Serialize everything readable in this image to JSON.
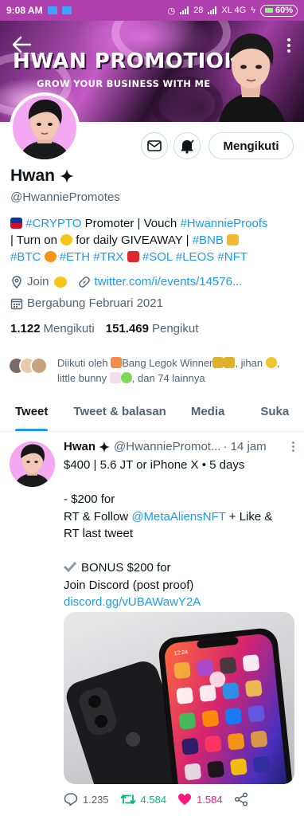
{
  "status_bar": {
    "time": "9:08 AM",
    "notification_badge": "28",
    "network": "XL 4G",
    "battery": "60%"
  },
  "banner": {
    "title": "HWAN PROMOTIONS",
    "subtitle": "GROW YOUR BUSINESS WITH ME"
  },
  "profile": {
    "follow_label": "Mengikuti",
    "name": "Hwan",
    "handle": "@HwanniePromotes",
    "bio": {
      "line1_tag": "#CRYPTO",
      "line1_text": " Promoter | Vouch ",
      "line1_link": "#HwannieProofs",
      "line2_a": "| Turn on ",
      "line2_b": " for daily GIVEAWAY | ",
      "line2_tag": "#BNB",
      "line3_btc": "#BTC",
      "line3_eth": "#ETH",
      "line3_trx": "#TRX",
      "line3_sol": "#SOL",
      "line3_leos": "#LEOS",
      "line3_nft": "#NFT"
    },
    "location": "Join",
    "url": "twitter.com/i/events/14576...",
    "joined": "Bergabung Februari 2021",
    "following_count": "1.122",
    "following_label": "Mengikuti",
    "followers_count": "151.469",
    "followers_label": "Pengikut",
    "followed_by_a": "Diikuti oleh ",
    "followed_by_b": "Bang Legok Winner",
    "followed_by_c": ", jihan",
    "followed_by_d": ", little bunny ",
    "followed_by_e": ", dan 74 lainnya"
  },
  "tabs": [
    "Tweet",
    "Tweet & balasan",
    "Media",
    "Suka"
  ],
  "tweet": {
    "name": "Hwan",
    "handle": "@HwanniePromot...",
    "time": "· 14 jam",
    "lines": {
      "l1": "$400 | 5.6 JT or iPhone X • 5 days",
      "l2": "",
      "l3": "- $200 for",
      "l4a": "RT & Follow ",
      "l4b": "@MetaAliensNFT",
      "l4c": " + Like &",
      "l5": "RT last tweet",
      "l6": "",
      "l7": "BONUS $200 for",
      "l8": "Join Discord (post proof)",
      "l9": "discord.gg/vUBAWawY2A"
    },
    "phone_time": "12:24",
    "replies": "1.235",
    "retweets": "4.584",
    "likes": "1.584"
  },
  "colors": {
    "accent": "#1d9bf0",
    "retweet": "#00ba7c",
    "like": "#f91880",
    "status_bar": "#b03fae"
  }
}
